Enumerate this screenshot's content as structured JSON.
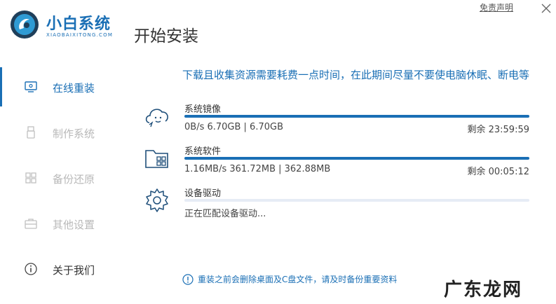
{
  "app": {
    "brand_name": "小白系统",
    "brand_sub": "XIAOBAIXITONG.COM",
    "page_title": "开始安装",
    "disclaimer": "免责声明",
    "accent_color": "#1a6fb5"
  },
  "sidebar": {
    "items": [
      {
        "label": "在线重装",
        "icon": "monitor-icon",
        "state": "active"
      },
      {
        "label": "制作系统",
        "icon": "usb-icon",
        "state": "disabled"
      },
      {
        "label": "备份还原",
        "icon": "grid-icon",
        "state": "disabled"
      },
      {
        "label": "其他设置",
        "icon": "briefcase-icon",
        "state": "disabled"
      },
      {
        "label": "关于我们",
        "icon": "info-icon",
        "state": "normal"
      }
    ]
  },
  "main": {
    "notice": "下载且收集资源需要耗费一点时间，在此期间尽量不要使电脑休眠、断电等",
    "tasks": [
      {
        "name": "系统镜像",
        "icon": "cloud-face-icon",
        "info": "0B/s 6.70GB | 6.70GB",
        "remaining": "剩余 23:59:59",
        "progress": 1.0
      },
      {
        "name": "系统软件",
        "icon": "folder-apps-icon",
        "info": "1.16MB/s 361.72MB | 362.88MB",
        "remaining": "剩余 00:05:12",
        "progress": 1.0
      },
      {
        "name": "设备驱动",
        "icon": "gear-icon",
        "info": "正在匹配设备驱动...",
        "remaining": "",
        "progress": 0.0
      }
    ],
    "warning": "重装之前会删除桌面及C盘文件，请及时备份重要资料"
  },
  "watermark": "广东龙网"
}
